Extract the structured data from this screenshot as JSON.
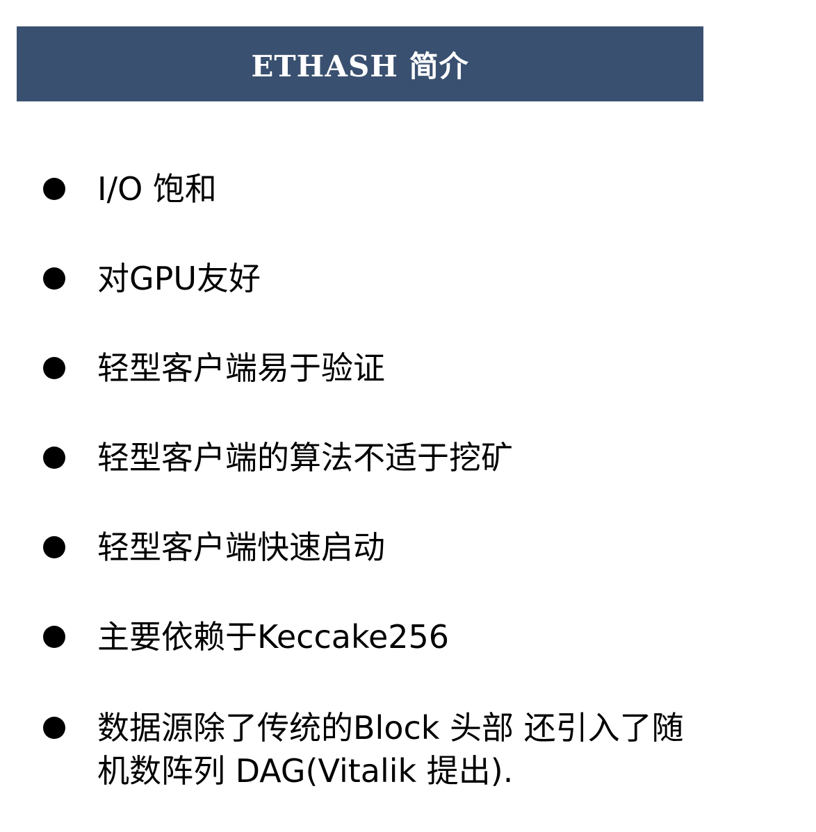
{
  "slide": {
    "title": "ETHASH 简介",
    "theme_color": "#3a5070",
    "bullets": [
      "I/O 饱和",
      "对GPU友好",
      "轻型客户端易于验证",
      "轻型客户端的算法不适于挖矿",
      "轻型客户端快速启动",
      "主要依赖于Keccake256",
      "数据源除了传统的Block 头部 还引入了随机数阵列 DAG(Vitalik 提出)."
    ]
  }
}
